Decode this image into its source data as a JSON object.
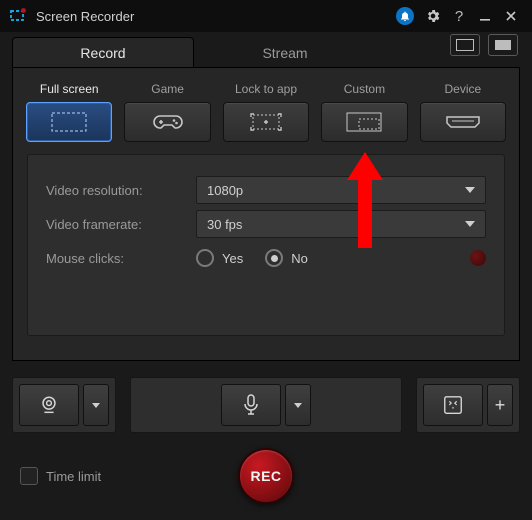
{
  "titlebar": {
    "title": "Screen Recorder"
  },
  "tabs": {
    "record": "Record",
    "stream": "Stream"
  },
  "modes": {
    "full_screen": "Full screen",
    "game": "Game",
    "lock_to_app": "Lock to app",
    "custom": "Custom",
    "device": "Device"
  },
  "settings": {
    "resolution_label": "Video resolution:",
    "resolution_value": "1080p",
    "framerate_label": "Video framerate:",
    "framerate_value": "30 fps",
    "mouse_label": "Mouse clicks:",
    "mouse_yes": "Yes",
    "mouse_no": "No",
    "mouse_selected": "No"
  },
  "footer": {
    "time_limit": "Time limit",
    "rec": "REC"
  },
  "colors": {
    "accent": "#c81922",
    "selected": "#2a4d82"
  }
}
